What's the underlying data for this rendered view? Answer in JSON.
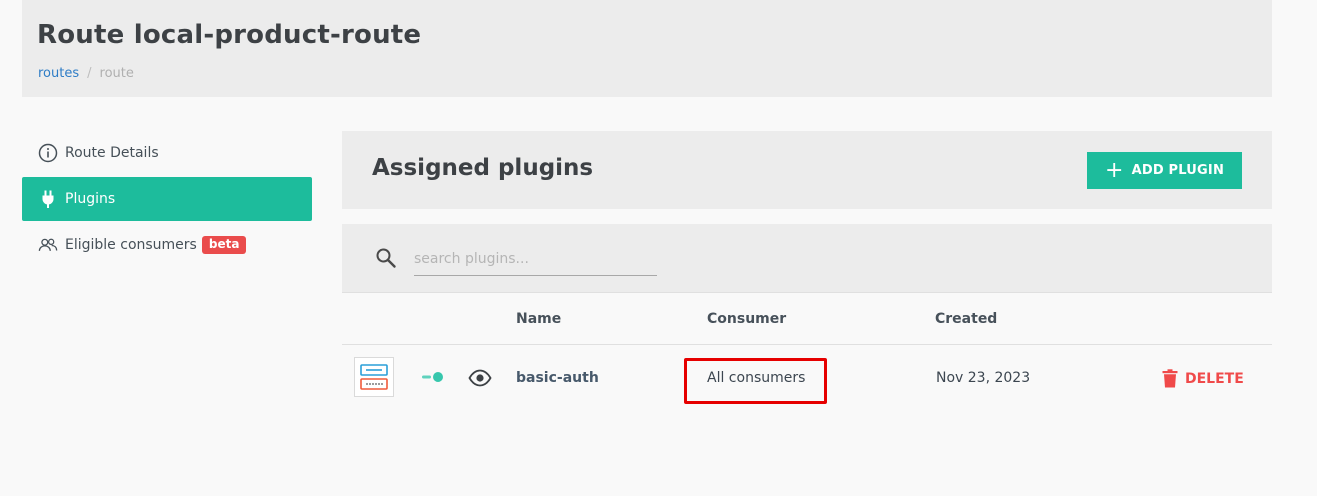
{
  "header": {
    "title": "Route local-product-route",
    "breadcrumb": {
      "link": "routes",
      "separator": "/",
      "current": "route"
    }
  },
  "sidebar": {
    "items": [
      {
        "label": "Route Details",
        "icon": "info-icon",
        "active": false
      },
      {
        "label": "Plugins",
        "icon": "plug-icon",
        "active": true
      },
      {
        "label": "Eligible consumers",
        "icon": "users-icon",
        "active": false,
        "badge": "beta"
      }
    ]
  },
  "panel": {
    "title": "Assigned plugins",
    "add_button_label": "ADD PLUGIN"
  },
  "search": {
    "placeholder": "search plugins..."
  },
  "table": {
    "columns": {
      "name": "Name",
      "consumer": "Consumer",
      "created": "Created"
    },
    "rows": [
      {
        "name": "basic-auth",
        "consumer": "All consumers",
        "created": "Nov 23, 2023",
        "delete_label": "DELETE",
        "enabled": true
      }
    ]
  },
  "colors": {
    "accent": "#1dbc9c",
    "danger": "#f04a4a",
    "link": "#2f7dc6",
    "highlight": "#e60000"
  }
}
